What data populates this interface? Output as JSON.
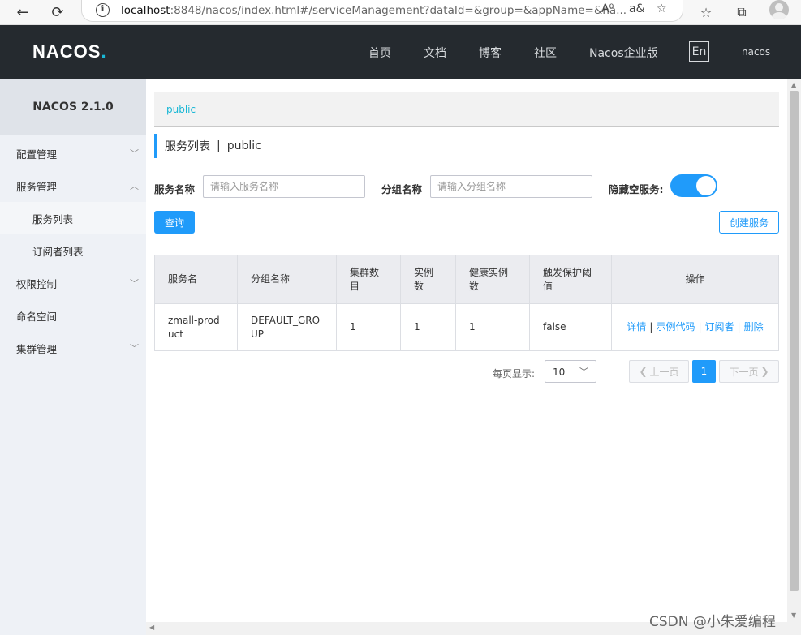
{
  "browser": {
    "url_host": "localhost",
    "url_rest": ":8848/nacos/index.html#/serviceManagement?dataId=&group=&appName=&na..."
  },
  "topnav": {
    "logo_main": "NAC",
    "logo_o": "O",
    "logo_end": "S",
    "logo_dot": ".",
    "items": [
      "首页",
      "文档",
      "博客",
      "社区",
      "Nacos企业版"
    ],
    "lang": "En",
    "user": "nacos"
  },
  "sidebar": {
    "title": "NACOS 2.1.0",
    "items": [
      {
        "label": "配置管理",
        "chevron": "﹀"
      },
      {
        "label": "服务管理",
        "chevron": "︿"
      },
      {
        "label": "服务列表"
      },
      {
        "label": "订阅者列表"
      },
      {
        "label": "权限控制",
        "chevron": "﹀"
      },
      {
        "label": "命名空间"
      },
      {
        "label": "集群管理",
        "chevron": "﹀"
      }
    ]
  },
  "main": {
    "namespace": "public",
    "page_title": "服务列表",
    "title_sep": "|",
    "title_ns": "public",
    "filters": {
      "service_label": "服务名称",
      "service_placeholder": "请输入服务名称",
      "group_label": "分组名称",
      "group_placeholder": "请输入分组名称",
      "hide_empty_label": "隐藏空服务:",
      "hide_empty_on": true
    },
    "query_button": "查询",
    "create_button": "创建服务",
    "table": {
      "headers": [
        "服务名",
        "分组名称",
        "集群数目",
        "实例数",
        "健康实例数",
        "触发保护阈值",
        "操作"
      ],
      "rows": [
        {
          "name": "zmall-product",
          "group": "DEFAULT_GROUP",
          "clusters": "1",
          "instances": "1",
          "healthy": "1",
          "protect": "false",
          "actions": [
            "详情",
            "示例代码",
            "订阅者",
            "删除"
          ],
          "action_sep": "|"
        }
      ]
    },
    "pagination": {
      "per_page_label": "每页显示:",
      "per_page": "10",
      "prev": "上一页",
      "next": "下一页",
      "current": "1"
    }
  },
  "watermark": "CSDN @小朱爱编程",
  "colors": {
    "primary": "#209bfa",
    "nav_bg": "#252a2f",
    "sidebar_bg": "#eef1f6",
    "accent_cyan": "#19b7d5"
  }
}
